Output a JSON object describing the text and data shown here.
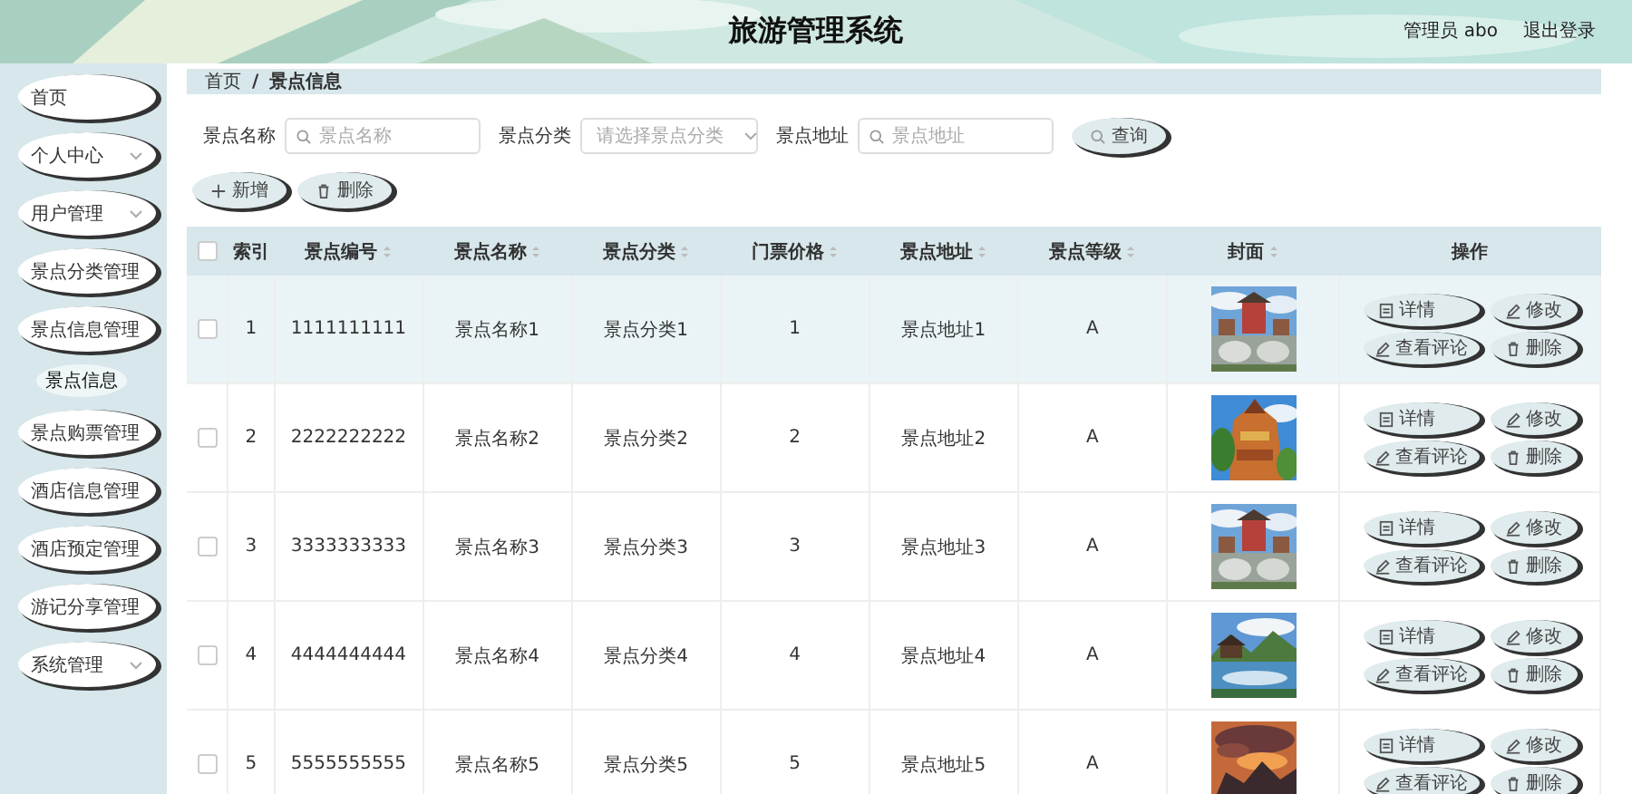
{
  "header": {
    "title": "旅游管理系统",
    "user": "管理员 abo",
    "logout": "退出登录"
  },
  "sidebar": {
    "items": [
      {
        "label": "首页",
        "has_submenu": false
      },
      {
        "label": "个人中心",
        "has_submenu": true
      },
      {
        "label": "用户管理",
        "has_submenu": true
      },
      {
        "label": "景点分类管理",
        "has_submenu": false
      },
      {
        "label": "景点信息管理",
        "has_submenu": true,
        "children": [
          {
            "label": "景点信息",
            "selected": true
          }
        ]
      },
      {
        "label": "景点购票管理",
        "has_submenu": false
      },
      {
        "label": "酒店信息管理",
        "has_submenu": false
      },
      {
        "label": "酒店预定管理",
        "has_submenu": false
      },
      {
        "label": "游记分享管理",
        "has_submenu": false
      },
      {
        "label": "系统管理",
        "has_submenu": true
      }
    ]
  },
  "breadcrumb": {
    "items": [
      "首页",
      "景点信息"
    ],
    "separator": "/"
  },
  "search": {
    "fields": [
      {
        "label": "景点名称",
        "kind": "input",
        "placeholder": "景点名称"
      },
      {
        "label": "景点分类",
        "kind": "select",
        "placeholder": "请选择景点分类"
      },
      {
        "label": "景点地址",
        "kind": "input",
        "placeholder": "景点地址"
      }
    ],
    "button": "查询"
  },
  "actions": [
    {
      "label": "新增",
      "kind": "add"
    },
    {
      "label": "删除",
      "kind": "delete"
    }
  ],
  "table": {
    "all_checked": false,
    "columns": [
      {
        "label": "索引",
        "sortable": false
      },
      {
        "label": "景点编号",
        "sortable": true
      },
      {
        "label": "景点名称",
        "sortable": true
      },
      {
        "label": "景点分类",
        "sortable": true
      },
      {
        "label": "门票价格",
        "sortable": true
      },
      {
        "label": "景点地址",
        "sortable": true
      },
      {
        "label": "景点等级",
        "sortable": true
      },
      {
        "label": "封面",
        "sortable": true
      },
      {
        "label": "操作",
        "sortable": false
      }
    ],
    "rows": [
      {
        "checked": false,
        "hovered": true,
        "cells": [
          "1",
          "1111111111",
          "景点名称1",
          "景点分类1",
          "1",
          "景点地址1",
          "A"
        ],
        "cover": {
          "kind": "picture"
        },
        "actions": [
          {
            "label": "详情",
            "kind": "detail"
          },
          {
            "label": "修改",
            "kind": "edit"
          },
          {
            "label": "查看评论",
            "kind": "comments"
          },
          {
            "label": "删除",
            "kind": "delete"
          }
        ]
      },
      {
        "checked": false,
        "hovered": false,
        "cells": [
          "2",
          "2222222222",
          "景点名称2",
          "景点分类2",
          "2",
          "景点地址2",
          "A"
        ],
        "cover": {
          "kind": "picture"
        },
        "actions": [
          {
            "label": "详情",
            "kind": "detail"
          },
          {
            "label": "修改",
            "kind": "edit"
          },
          {
            "label": "查看评论",
            "kind": "comments"
          },
          {
            "label": "删除",
            "kind": "delete"
          }
        ]
      },
      {
        "checked": false,
        "hovered": false,
        "cells": [
          "3",
          "3333333333",
          "景点名称3",
          "景点分类3",
          "3",
          "景点地址3",
          "A"
        ],
        "cover": {
          "kind": "picture"
        },
        "actions": [
          {
            "label": "详情",
            "kind": "detail"
          },
          {
            "label": "修改",
            "kind": "edit"
          },
          {
            "label": "查看评论",
            "kind": "comments"
          },
          {
            "label": "删除",
            "kind": "delete"
          }
        ]
      },
      {
        "checked": false,
        "hovered": false,
        "cells": [
          "4",
          "4444444444",
          "景点名称4",
          "景点分类4",
          "4",
          "景点地址4",
          "A"
        ],
        "cover": {
          "kind": "picture"
        },
        "actions": [
          {
            "label": "详情",
            "kind": "detail"
          },
          {
            "label": "修改",
            "kind": "edit"
          },
          {
            "label": "查看评论",
            "kind": "comments"
          },
          {
            "label": "删除",
            "kind": "delete"
          }
        ]
      },
      {
        "checked": false,
        "hovered": false,
        "cells": [
          "5",
          "5555555555",
          "景点名称5",
          "景点分类5",
          "5",
          "景点地址5",
          "A"
        ],
        "cover": {
          "kind": "picture"
        },
        "actions": [
          {
            "label": "详情",
            "kind": "detail"
          },
          {
            "label": "修改",
            "kind": "edit"
          },
          {
            "label": "查看评论",
            "kind": "comments"
          },
          {
            "label": "删除",
            "kind": "delete"
          }
        ]
      }
    ]
  }
}
